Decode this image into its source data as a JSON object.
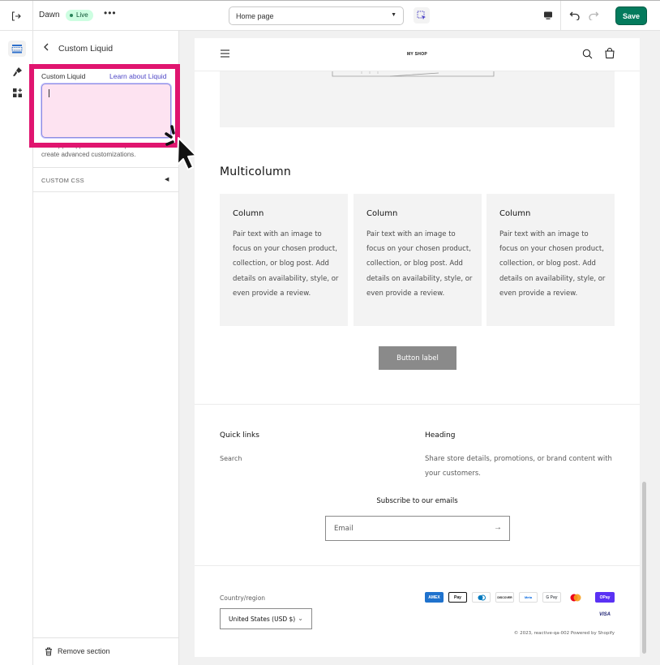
{
  "topbar": {
    "theme_name": "Dawn",
    "live_badge": "Live",
    "more_label": "•••",
    "page_select": "Home page",
    "save_label": "Save"
  },
  "sidebar": {
    "title": "Custom Liquid",
    "field_label": "Custom Liquid",
    "learn_link": "Learn about Liquid",
    "textarea_value": "",
    "help_text": "Add app snippets or other Liquid code to create advanced customizations.",
    "custom_css_label": "CUSTOM CSS",
    "remove_label": "Remove section"
  },
  "preview": {
    "logo": "MY SHOP",
    "multicolumn_heading": "Multicolumn",
    "columns": [
      {
        "title": "Column",
        "text": "Pair text with an image to focus on your chosen product, collection, or blog post. Add details on availability, style, or even provide a review."
      },
      {
        "title": "Column",
        "text": "Pair text with an image to focus on your chosen product, collection, or blog post. Add details on availability, style, or even provide a review."
      },
      {
        "title": "Column",
        "text": "Pair text with an image to focus on your chosen product, collection, or blog post. Add details on availability, style, or even provide a review."
      }
    ],
    "button_label": "Button label",
    "quick_links_heading": "Quick links",
    "quick_links": [
      "Search"
    ],
    "footer_heading": "Heading",
    "footer_text": "Share store details, promotions, or brand content with your customers.",
    "subscribe_heading": "Subscribe to our emails",
    "email_placeholder": "Email",
    "country_label": "Country/region",
    "country_value": "United States (USD $)",
    "payment_icons": [
      "AMEX",
      "Pay",
      "",
      "DISCOVER",
      "Meta",
      "G Pay",
      "",
      "OPay",
      "VISA"
    ],
    "copyright": "© 2023, reactive-qa-002 Powered by Shopify"
  },
  "colors": {
    "save_button": "#047b5d",
    "highlight": "#e0156f",
    "link": "#4f47c6",
    "live_badge_bg": "#cdfee1"
  }
}
